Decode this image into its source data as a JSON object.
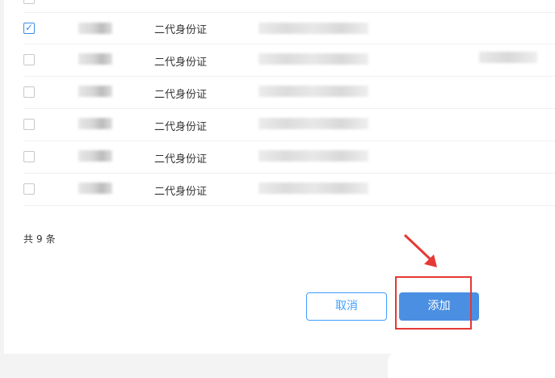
{
  "table": {
    "rows": [
      {
        "checked": true,
        "doc_type": "二代身份证"
      },
      {
        "checked": false,
        "doc_type": "二代身份证"
      },
      {
        "checked": false,
        "doc_type": "二代身份证"
      },
      {
        "checked": false,
        "doc_type": "二代身份证"
      },
      {
        "checked": false,
        "doc_type": "二代身份证"
      },
      {
        "checked": false,
        "doc_type": "二代身份证"
      }
    ]
  },
  "footer": {
    "total_prefix": "共",
    "total_count": "9",
    "total_suffix": "条"
  },
  "actions": {
    "cancel_label": "取消",
    "add_label": "添加"
  },
  "colors": {
    "primary": "#4a8fe2",
    "annotation_red": "#e53935"
  }
}
